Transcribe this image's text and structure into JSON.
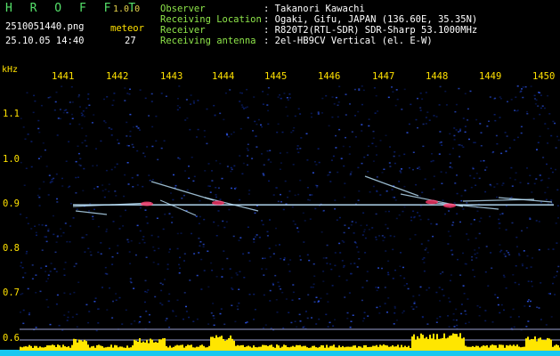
{
  "header": {
    "logo": "H R O F F T",
    "version": "1.0.0",
    "filename": "2510051440.png",
    "datetime": "25.10.05 14:40",
    "meteor_label": "meteor",
    "meteor_count": "27",
    "fields": [
      {
        "label": "Observer",
        "value": ": Takanori Kawachi"
      },
      {
        "label": "Receiving Location",
        "value": ": Ogaki, Gifu, JAPAN (136.60E, 35.35N)"
      },
      {
        "label": "Receiver",
        "value": ": R820T2(RTL-SDR) SDR-Sharp 53.1000MHz"
      },
      {
        "label": "Receiving antenna",
        "value": ": 2el-HB9CV Vertical (el. E-W)"
      }
    ]
  },
  "chart_data": {
    "type": "heatmap",
    "title": "",
    "ylabel": "kHz",
    "x_ticks": [
      "1441",
      "1442",
      "1443",
      "1444",
      "1445",
      "1446",
      "1447",
      "1448",
      "1449",
      "1450"
    ],
    "y_ticks": [
      "1.1",
      "1.0",
      "0.9",
      "0.8",
      "0.7",
      "0.6"
    ],
    "ylim": [
      0.585,
      1.15
    ],
    "carrier_khz": 0.9,
    "colors": {
      "background": "#000000",
      "noise_low": "#0a1f6e",
      "noise_high": "#2a4fd8",
      "trace": "#bfe6ff",
      "hot": "#ff3a6a",
      "tick_label": "#ffe100",
      "grid": "#9aa0d0",
      "level_bar": "#ffe600",
      "level_base": "#18c8f0"
    }
  }
}
